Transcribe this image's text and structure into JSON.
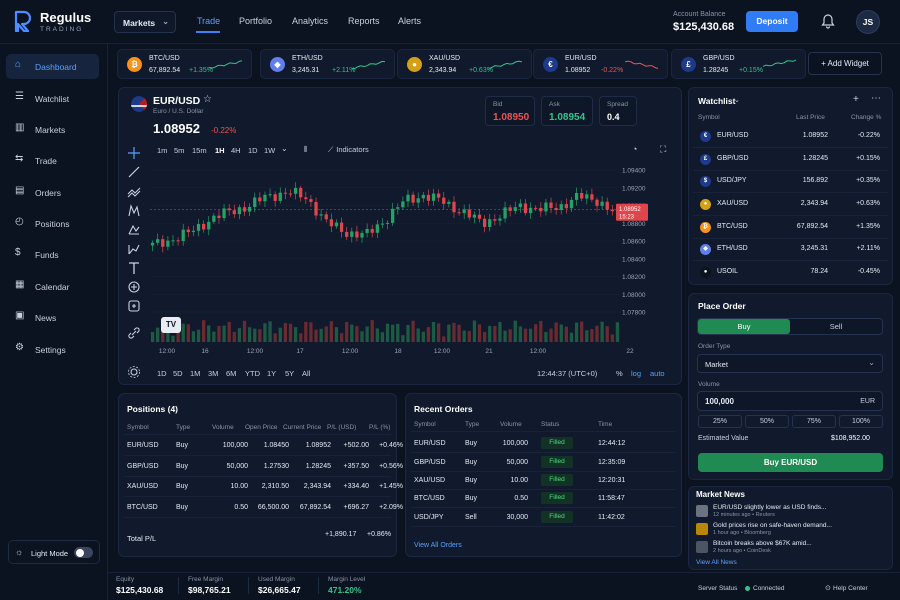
{
  "brand": {
    "name": "Regulus",
    "sub": "TRADING"
  },
  "header": {
    "market_select": "Markets",
    "tabs": [
      "Trade",
      "Portfolio",
      "Analytics",
      "Reports",
      "Alerts"
    ],
    "account_label": "Account Balance",
    "account_value": "$125,430.68",
    "deposit_label": "Deposit",
    "avatar_initials": "JS"
  },
  "sidebar": {
    "items": [
      {
        "label": "Dashboard",
        "icon": "home-icon"
      },
      {
        "label": "Watchlist",
        "icon": "watchlist-icon"
      },
      {
        "label": "Markets",
        "icon": "markets-icon"
      },
      {
        "label": "Trade",
        "icon": "trade-icon"
      },
      {
        "label": "Orders",
        "icon": "orders-icon"
      },
      {
        "label": "Positions",
        "icon": "positions-icon"
      },
      {
        "label": "Funds",
        "icon": "funds-icon"
      },
      {
        "label": "Calendar",
        "icon": "calendar-icon"
      },
      {
        "label": "News",
        "icon": "news-icon"
      },
      {
        "label": "Settings",
        "icon": "settings-icon"
      }
    ],
    "light_mode_label": "Light Mode"
  },
  "tickers": [
    {
      "symbol": "BTC/USD",
      "price": "67,892.54",
      "change": "+1.35%",
      "dir": "up"
    },
    {
      "symbol": "ETH/USD",
      "price": "3,245.31",
      "change": "+2.11%",
      "dir": "up"
    },
    {
      "symbol": "XAU/USD",
      "price": "2,343.94",
      "change": "+0.63%",
      "dir": "up"
    },
    {
      "symbol": "EUR/USD",
      "price": "1.08952",
      "change": "-0.22%",
      "dir": "down"
    },
    {
      "symbol": "GBP/USD",
      "price": "1.28245",
      "change": "+0.15%",
      "dir": "up"
    }
  ],
  "add_widget_label": "+ Add Widget",
  "chart": {
    "pair": "EUR/USD",
    "description": "Euro / U.S. Dollar",
    "price": "1.08952",
    "change": "-0.22%",
    "bid_label": "Bid",
    "bid": "1.08950",
    "ask_label": "Ask",
    "ask": "1.08954",
    "spread_label": "Spread",
    "spread": "0.4",
    "timeframes": [
      "1m",
      "5m",
      "15m",
      "1H",
      "4H",
      "1D",
      "1W"
    ],
    "selected_timeframe": "1H",
    "indicators_label": "Indicators",
    "price_axis": [
      "1.09400",
      "1.09200",
      "1.09000",
      "1.08800",
      "1.08600",
      "1.08400",
      "1.08200",
      "1.08000",
      "1.07800"
    ],
    "time_axis": [
      "12:00",
      "16",
      "12:00",
      "17",
      "12:00",
      "18",
      "12:00",
      "21",
      "12:00",
      "22"
    ],
    "current_tag": "1.08952",
    "countdown_tag": "15:23",
    "ranges": [
      "1D",
      "5D",
      "1M",
      "3M",
      "6M",
      "YTD",
      "1Y",
      "5Y",
      "All"
    ],
    "clock": "12:44:37 (UTC+0)",
    "scale_options": [
      "%",
      "log",
      "auto"
    ]
  },
  "positions": {
    "title": "Positions (4)",
    "columns": [
      "Symbol",
      "Type",
      "Volume",
      "Open Price",
      "Current Price",
      "P/L (USD)",
      "P/L (%)"
    ],
    "rows": [
      [
        "EUR/USD",
        "Buy",
        "100,000",
        "1.08450",
        "1.08952",
        "+502.00",
        "+0.46%"
      ],
      [
        "GBP/USD",
        "Buy",
        "50,000",
        "1.27530",
        "1.28245",
        "+357.50",
        "+0.56%"
      ],
      [
        "XAU/USD",
        "Buy",
        "10.00",
        "2,310.50",
        "2,343.94",
        "+334.40",
        "+1.45%"
      ],
      [
        "BTC/USD",
        "Buy",
        "0.50",
        "66,500.00",
        "67,892.54",
        "+696.27",
        "+2.09%"
      ]
    ],
    "total_label": "Total P/L",
    "total_usd": "+1,890.17",
    "total_pct": "+0.86%"
  },
  "orders": {
    "title": "Recent Orders",
    "columns": [
      "Symbol",
      "Type",
      "Volume",
      "Status",
      "Time"
    ],
    "rows": [
      [
        "EUR/USD",
        "Buy",
        "100,000",
        "Filled",
        "12:44:12"
      ],
      [
        "GBP/USD",
        "Buy",
        "50,000",
        "Filled",
        "12:35:09"
      ],
      [
        "XAU/USD",
        "Buy",
        "10.00",
        "Filled",
        "12:20:31"
      ],
      [
        "BTC/USD",
        "Buy",
        "0.50",
        "Filled",
        "11:58:47"
      ],
      [
        "USD/JPY",
        "Sell",
        "30,000",
        "Filled",
        "11:42:02"
      ]
    ],
    "view_all": "View All Orders"
  },
  "watchlist": {
    "title": "Watchlist",
    "columns": [
      "Symbol",
      "Last Price",
      "Change %"
    ],
    "rows": [
      [
        "EUR/USD",
        "1.08952",
        "-0.22%"
      ],
      [
        "GBP/USD",
        "1.28245",
        "+0.15%"
      ],
      [
        "USD/JPY",
        "156.892",
        "+0.35%"
      ],
      [
        "XAU/USD",
        "2,343.94",
        "+0.63%"
      ],
      [
        "BTC/USD",
        "67,892.54",
        "+1.35%"
      ],
      [
        "ETH/USD",
        "3,245.31",
        "+2.11%"
      ],
      [
        "USOIL",
        "78.24",
        "-0.45%"
      ]
    ]
  },
  "place_order": {
    "title": "Place Order",
    "buy": "Buy",
    "sell": "Sell",
    "order_type_label": "Order Type",
    "order_type": "Market",
    "volume_label": "Volume",
    "volume": "100,000",
    "currency": "EUR",
    "presets": [
      "25%",
      "50%",
      "75%",
      "100%"
    ],
    "estimated_label": "Estimated Value",
    "estimated_value": "$108,952.00",
    "submit": "Buy EUR/USD"
  },
  "news": {
    "title": "Market News",
    "items": [
      {
        "headline": "EUR/USD slightly lower as USD finds...",
        "meta": "12 minutes ago • Reuters"
      },
      {
        "headline": "Gold prices rise on safe-haven demand...",
        "meta": "1 hour ago • Bloomberg"
      },
      {
        "headline": "Bitcoin breaks above $67K amid...",
        "meta": "2 hours ago • CoinDesk"
      }
    ],
    "view_all": "View All News"
  },
  "footer": {
    "equity_label": "Equity",
    "equity": "$125,430.68",
    "free_margin_label": "Free Margin",
    "free_margin": "$98,765.21",
    "used_margin_label": "Used Margin",
    "used_margin": "$26,665.47",
    "margin_level_label": "Margin Level",
    "margin_level": "471.20%",
    "server_label": "Server Status",
    "server_value": "Connected",
    "help_label": "Help Center"
  },
  "colors": {
    "accent": "#2f7cf6",
    "up": "#31c48d",
    "down": "#f05252",
    "background": "#0b1220"
  }
}
